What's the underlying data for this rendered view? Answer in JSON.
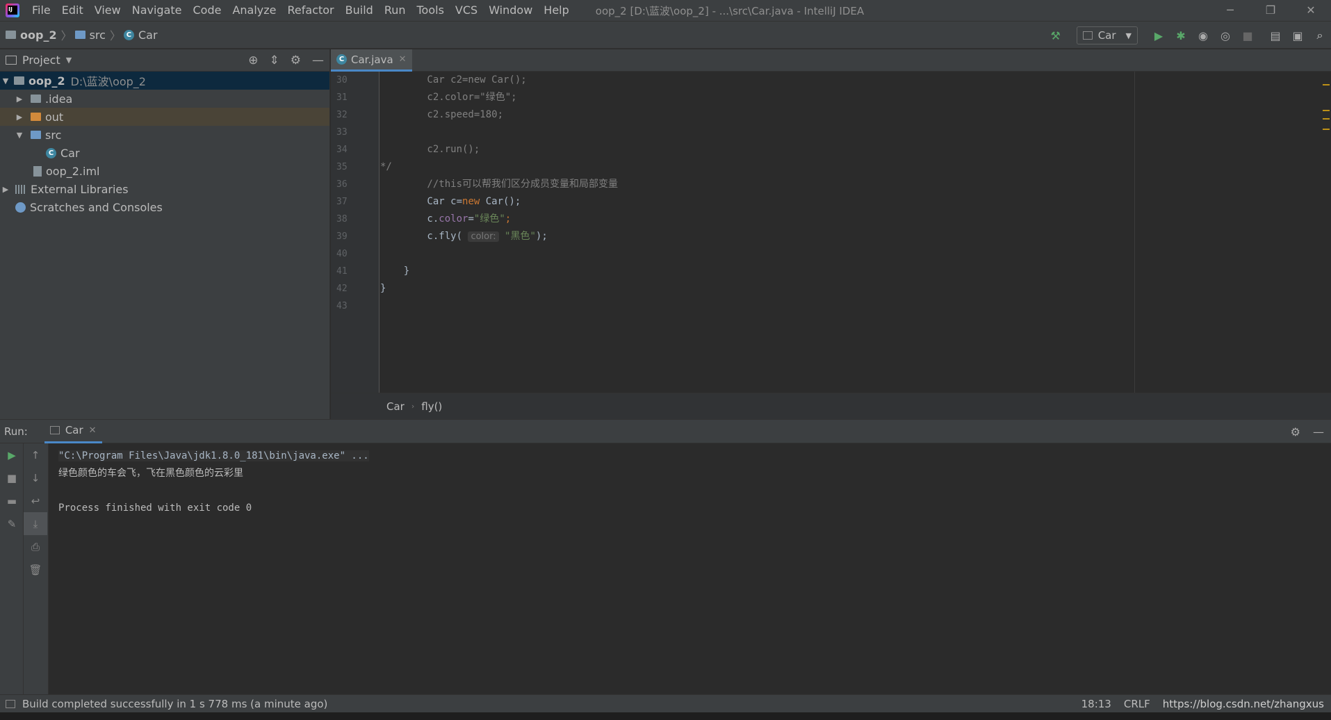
{
  "window": {
    "title": "oop_2 [D:\\蓝波\\oop_2] - ...\\src\\Car.java - IntelliJ IDEA",
    "controls": [
      "─",
      "❐",
      "✕"
    ]
  },
  "menu": [
    "File",
    "Edit",
    "View",
    "Navigate",
    "Code",
    "Analyze",
    "Refactor",
    "Build",
    "Run",
    "Tools",
    "VCS",
    "Window",
    "Help"
  ],
  "navbar": {
    "crumbs": [
      "oop_2",
      "src",
      "Car"
    ],
    "run_config": "Car"
  },
  "project": {
    "header": "Project",
    "tree": [
      {
        "label": "oop_2",
        "path": "D:\\蓝波\\oop_2"
      },
      {
        "label": ".idea"
      },
      {
        "label": "out"
      },
      {
        "label": "src"
      },
      {
        "label": "Car"
      },
      {
        "label": "oop_2.iml"
      },
      {
        "label": "External Libraries"
      },
      {
        "label": "Scratches and Consoles"
      }
    ]
  },
  "editor": {
    "tab": "Car.java",
    "line_numbers": [
      "30",
      "31",
      "32",
      "33",
      "34",
      "35",
      "36",
      "37",
      "38",
      "39",
      "40",
      "41",
      "42",
      "43"
    ],
    "code": {
      "l30": "        Car c2=new Car();",
      "l31": "        c2.color=\"绿色\";",
      "l32": "        c2.speed=180;",
      "l34": "        c2.run();",
      "l35": "*/",
      "l36": "        //this可以帮我们区分成员变量和局部变量",
      "l37_a": "        Car c=",
      "l37_kw": "new",
      "l37_b": " Car();",
      "l38_a": "        c.",
      "l38_field": "color",
      "l38_b": "=",
      "l38_str": "\"绿色\"",
      "l38_c": ";",
      "l39_a": "        c.fly( ",
      "l39_hint": "color:",
      "l39_str": " \"黑色\"",
      "l39_b": ");",
      "l41": "    }",
      "l42": "}"
    },
    "breadcrumb": [
      "Car",
      "fly()"
    ]
  },
  "run": {
    "label": "Run:",
    "tab": "Car",
    "console": [
      "\"C:\\Program Files\\Java\\jdk1.8.0_181\\bin\\java.exe\" ...",
      "绿色颜色的车会飞，飞在黑色颜色的云彩里",
      "",
      "Process finished with exit code 0"
    ]
  },
  "status": {
    "message": "Build completed successfully in 1 s 778 ms (a minute ago)",
    "position": "18:13",
    "line_sep": "CRLF",
    "watermark": "https://blog.csdn.net/zhangxus"
  },
  "colors": {
    "accent": "#4a88c7",
    "run_green": "#59a869",
    "keyword": "#cc7832",
    "string": "#6a8759"
  }
}
